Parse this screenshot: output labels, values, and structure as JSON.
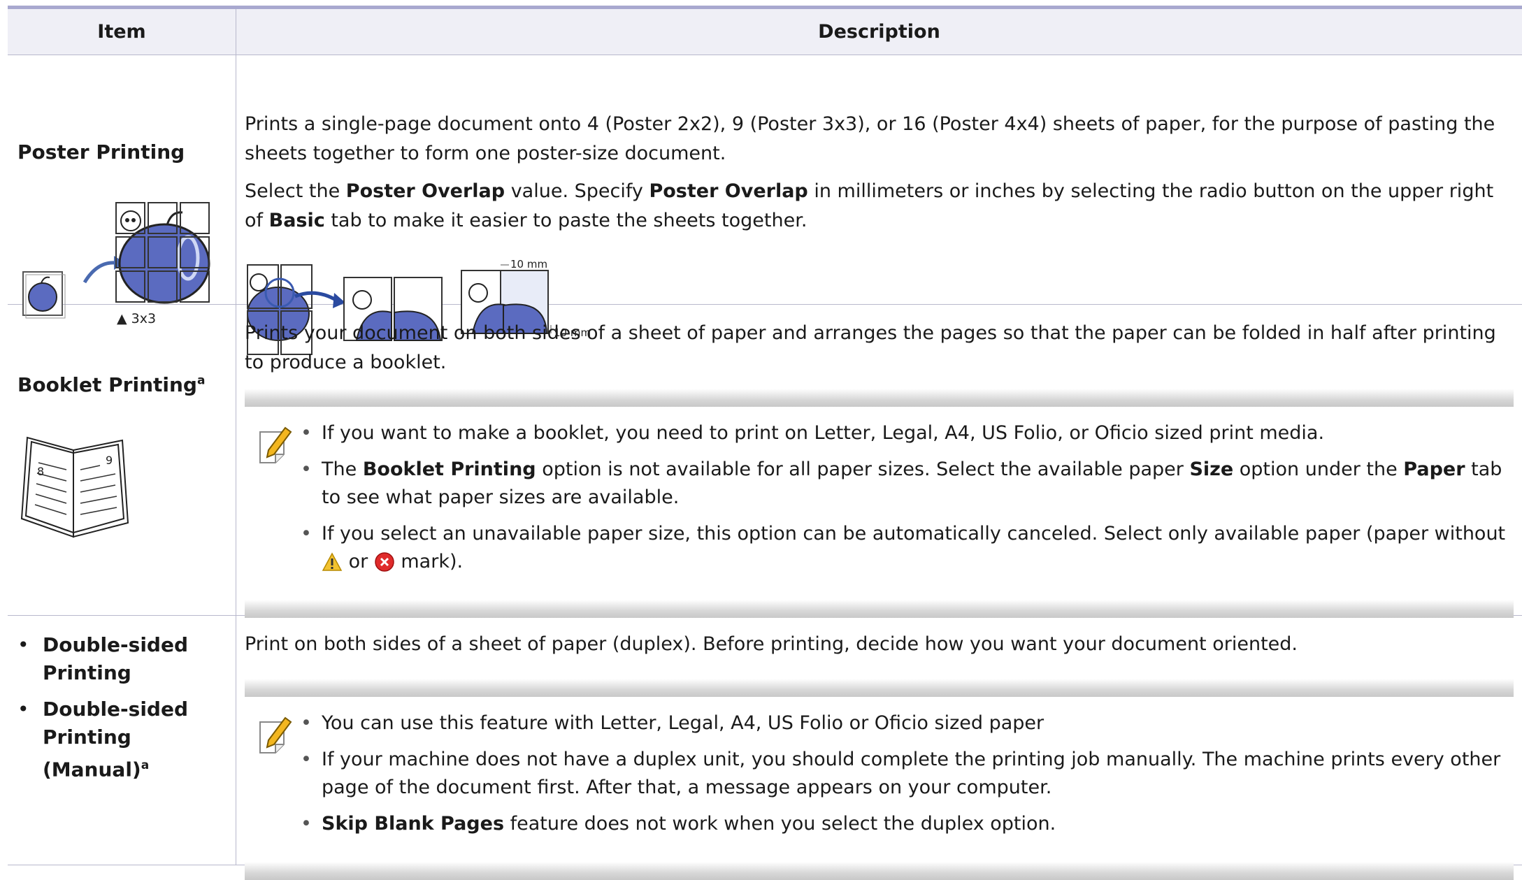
{
  "header": {
    "item": "Item",
    "description": "Description"
  },
  "rows": [
    {
      "item": "Poster Printing",
      "caption": "▲ 3x3",
      "desc1": "Prints a single-page document onto 4 (Poster 2x2), 9 (Poster 3x3), or 16 (Poster 4x4) sheets of paper, for the purpose of pasting the sheets together to form one poster-size document.",
      "desc2_a": "Select the ",
      "desc2_b": "Poster Overlap",
      "desc2_c": " value. Specify ",
      "desc2_d": "Poster Overlap",
      "desc2_e": " in millimeters or inches by selecting the radio button on the upper right of ",
      "desc2_f": "Basic",
      "desc2_g": " tab to make it easier to paste the sheets together.",
      "overlap_h": "10 mm",
      "overlap_v": "10 mm"
    },
    {
      "item": "Booklet Printing",
      "sup": "a",
      "desc": "Prints your document on both sides of a sheet of paper and arranges the pages so that the paper can be folded in half after printing to produce a booklet.",
      "note1": "If you want to make a booklet, you need to print on Letter, Legal, A4, US Folio, or Oficio sized print media.",
      "note2_a": "The ",
      "note2_b": "Booklet Printing",
      "note2_c": " option is not available for all paper sizes. Select the available paper ",
      "note2_d": "Size",
      "note2_e": " option under the ",
      "note2_f": "Paper",
      "note2_g": " tab to see what paper sizes are available.",
      "note3_a": "If you select an unavailable paper size, this option can be automatically canceled. Select only available paper (paper without ",
      "note3_b": " or ",
      "note3_c": " mark)."
    },
    {
      "item1": "Double-sided Printing",
      "item2": "Double-sided Printing (Manual)",
      "sup": "a",
      "desc": "Print on both sides of a sheet of paper (duplex). Before printing, decide how you want your document oriented.",
      "note1": "You can use this feature with Letter, Legal, A4, US Folio or Oficio sized paper",
      "note2": "If your machine does not have a duplex unit, you should complete the printing job manually. The machine prints every other page of the document first. After that, a message appears on your computer.",
      "note3_a": "Skip Blank Pages",
      "note3_b": " feature does not work when you select the duplex option."
    }
  ]
}
